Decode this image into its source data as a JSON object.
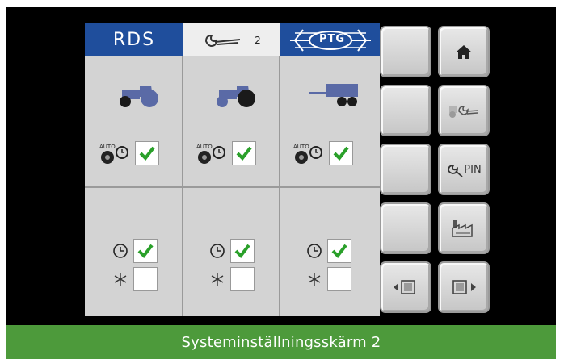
{
  "header": {
    "rds_label": "RDS",
    "wrench_tab_number": "2",
    "ptg_label": "PTG"
  },
  "columns": [
    {
      "vehicle_icon": "tractor-large-rear-wheel-icon",
      "auto_checked": true,
      "clock_checked": true,
      "snowflake_checked": false
    },
    {
      "vehicle_icon": "tractor-dark-rear-wheel-icon",
      "auto_checked": true,
      "clock_checked": true,
      "snowflake_checked": false
    },
    {
      "vehicle_icon": "trailer-icon",
      "auto_checked": true,
      "clock_checked": true,
      "snowflake_checked": false
    }
  ],
  "auto_label": "AUTO",
  "side_buttons": [
    {
      "name": "home-button",
      "icon": "home-icon"
    },
    {
      "name": "tractor-settings-button",
      "icon": "tractor-wrench-icon"
    },
    {
      "name": "pin-button",
      "icon": "wrench-pin-icon",
      "label": "PIN"
    },
    {
      "name": "factory-button",
      "icon": "factory-icon"
    },
    {
      "name": "previous-page-button",
      "icon": "arrow-left-screen-icon"
    },
    {
      "name": "next-page-button",
      "icon": "screen-arrow-right-icon"
    }
  ],
  "colors": {
    "header_blue": "#1f4e9c",
    "check_green": "#2aa02a",
    "footer_green": "#4d9a3b",
    "vehicle_blue": "#5a6aa6"
  },
  "footer": {
    "caption": "Systeminställningsskärm 2"
  }
}
